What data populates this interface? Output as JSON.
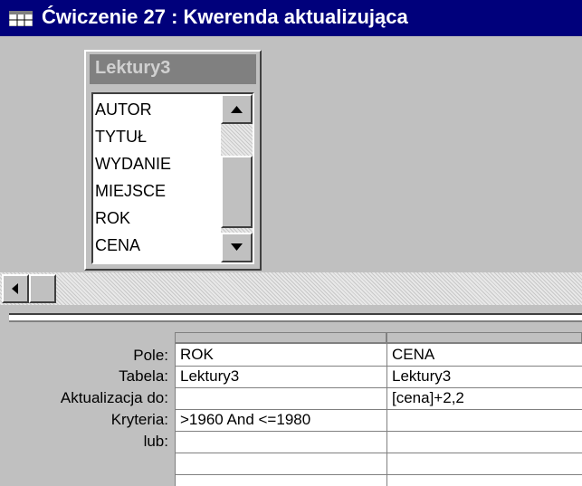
{
  "window": {
    "title": "Ćwiczenie 27 : Kwerenda aktualizująca",
    "icon": "query-window-icon"
  },
  "table": {
    "name": "Lektury3",
    "fields": [
      "AUTOR",
      "TYTUŁ",
      "WYDANIE",
      "MIEJSCE",
      "ROK",
      "CENA"
    ]
  },
  "grid": {
    "row_labels": [
      "Pole:",
      "Tabela:",
      "Aktualizacja do:",
      "Kryteria:",
      "lub:"
    ],
    "columns": [
      {
        "pole": "ROK",
        "tabela": "Lektury3",
        "aktualizacja": "",
        "kryteria": ">1960 And <=1980",
        "lub": ""
      },
      {
        "pole": "CENA",
        "tabela": "Lektury3",
        "aktualizacja": "[cena]+2,2",
        "kryteria": "",
        "lub": ""
      }
    ]
  },
  "colors": {
    "titlebar": "#00007b",
    "face": "#c0c0c0",
    "table_title": "#808080"
  }
}
